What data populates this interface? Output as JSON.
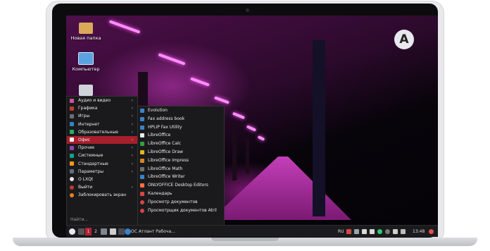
{
  "desktop": {
    "icons": [
      {
        "label": "Новая папка",
        "icon": "folder-icon"
      },
      {
        "label": "Компьютер",
        "icon": "computer-icon"
      }
    ],
    "logo": "A"
  },
  "start_menu": {
    "items": [
      {
        "label": "Аудио и видео",
        "color": "#d04ea0",
        "arrow": "›"
      },
      {
        "label": "Графика",
        "color": "#c0392b",
        "arrow": "›"
      },
      {
        "label": "Игры",
        "color": "#6d6d75",
        "arrow": "›"
      },
      {
        "label": "Интернет",
        "color": "#2e86c1",
        "arrow": "›"
      },
      {
        "label": "Образовательные",
        "color": "#27ae60",
        "arrow": "›"
      },
      {
        "label": "Офис",
        "color": "#f0f0f0",
        "arrow": "›",
        "selected": true
      },
      {
        "label": "Прочие",
        "color": "#8e44ad",
        "arrow": "›"
      },
      {
        "label": "Системные",
        "color": "#16a085",
        "arrow": "›"
      },
      {
        "label": "Стандартные",
        "color": "#f39c12",
        "arrow": "›"
      },
      {
        "label": "Параметры",
        "color": "#5d6d7e",
        "arrow": "›"
      },
      {
        "label": "О LXQt",
        "color": "#e5e5e5",
        "arrow": ""
      },
      {
        "label": "Выйти",
        "color": "#c0392b",
        "arrow": "›"
      },
      {
        "label": "Заблокировать экран",
        "color": "#e67e22",
        "arrow": ""
      }
    ],
    "search_placeholder": "Найти..."
  },
  "office_submenu": {
    "items": [
      {
        "label": "Evolution",
        "color": "#3b82c4"
      },
      {
        "label": "Fax address book",
        "color": "#3b82c4"
      },
      {
        "label": "HPLIP Fax Utility",
        "color": "#3b82c4"
      },
      {
        "label": "LibreOffice",
        "color": "#ececec"
      },
      {
        "label": "LibreOffice Calc",
        "color": "#2ea043"
      },
      {
        "label": "LibreOffice Draw",
        "color": "#e6b422"
      },
      {
        "label": "LibreOffice Impress",
        "color": "#d9822b"
      },
      {
        "label": "LibreOffice Math",
        "color": "#6e6e6e"
      },
      {
        "label": "LibreOffice Writer",
        "color": "#3b82c4"
      },
      {
        "label": "ONLYOFFICE Desktop Editors",
        "color": "#ff6f3d"
      },
      {
        "label": "Календарь",
        "color": "#d64541"
      },
      {
        "label": "Просмотр документов",
        "color": "#d64541"
      },
      {
        "label": "Просмотрщик документов Atril",
        "color": "#d64541"
      }
    ]
  },
  "taskbar": {
    "workspaces": [
      "1",
      "2"
    ],
    "window_title": "ОС Атлант Рабоча...",
    "language": "RU",
    "time": "13:48"
  }
}
